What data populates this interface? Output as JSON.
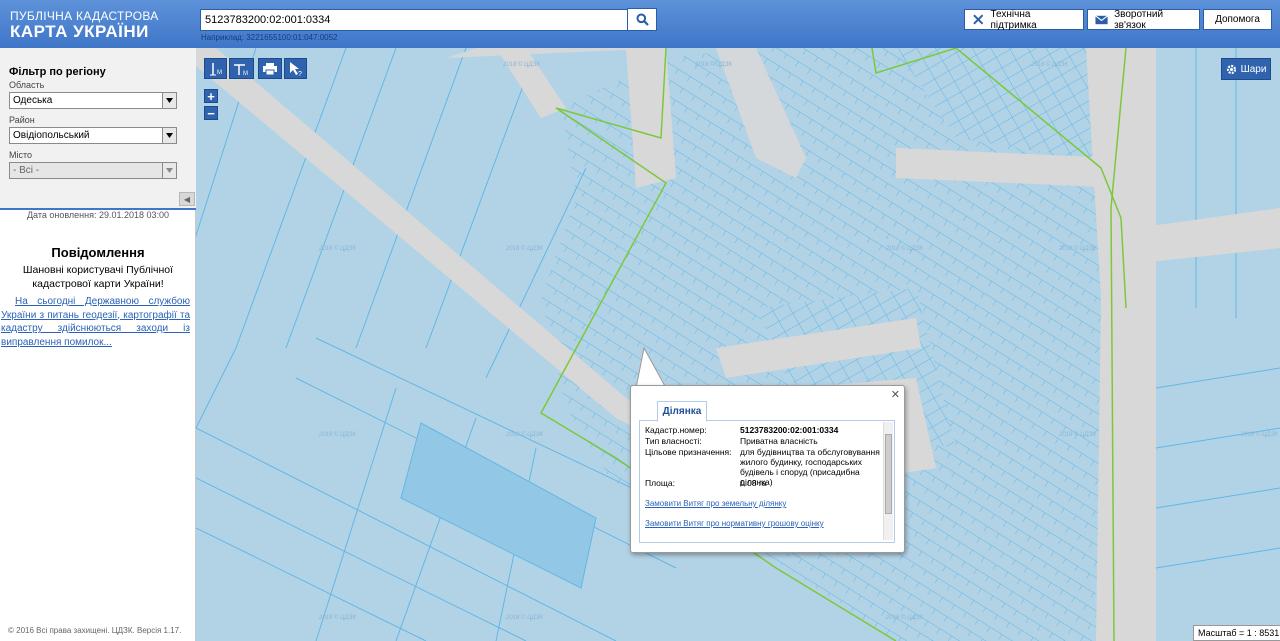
{
  "header": {
    "logo_line1": "ПУБЛІЧНА КАДАСТРОВА",
    "logo_line2": "КАРТА УКРАЇНИ",
    "search_value": "5123783200:02:001:0334",
    "example_text": "Наприклад: 3221655100:01:047:0052",
    "buttons": {
      "support": "Технічна підтримка",
      "feedback": "Зворотний зв'язок",
      "help": "Допомога"
    }
  },
  "sidebar": {
    "filter_title": "Фільтр по регіону",
    "region_label": "Область",
    "region_value": "Одеська",
    "district_label": "Район",
    "district_value": "Овідіопольський",
    "city_label": "Місто",
    "city_value": "- Всі -",
    "update_date": "Дата оновлення: 29.01.2018 03:00",
    "notice_title": "Повідомлення",
    "notice_greeting": "Шановні користувачі Публічної кадастрової карти України!",
    "notice_body": "На сьогодні Державною службою України з питань геодезії, картографії та кадастру здійснюються заходи із виправлення помилок...",
    "copyright": "© 2016 Всі права захищені. ЦДЗК. Версія 1.17."
  },
  "map": {
    "layers_label": "Шари",
    "scale_text": "Масштаб = 1 : 8531",
    "watermark": "2018 © ЦДЗК"
  },
  "popup": {
    "tab": "Ділянка",
    "labels": {
      "cadastral": "Кадастр.номер:",
      "ownership": "Тип власності:",
      "purpose": "Цільове призначення:",
      "area": "Площа:"
    },
    "values": {
      "cadastral": "5123783200:02:001:0334",
      "ownership": "Приватна власність",
      "purpose": "для будівництва та обслуговування жилого будинку, господарських будівель і споруд (присадибна ділянка)",
      "area": "0.08 га"
    },
    "link_extract": "Замовити Витяг про земельну ділянку",
    "link_valuation": "Замовити Витяг про нормативну грошову оцінку"
  },
  "colors": {
    "header": "#4a82d0",
    "map_parcel": "#b2d3e6",
    "parcel_border": "#63b6e6",
    "boundary_green": "#7cc83c",
    "road_gray": "#d8d8d8"
  }
}
